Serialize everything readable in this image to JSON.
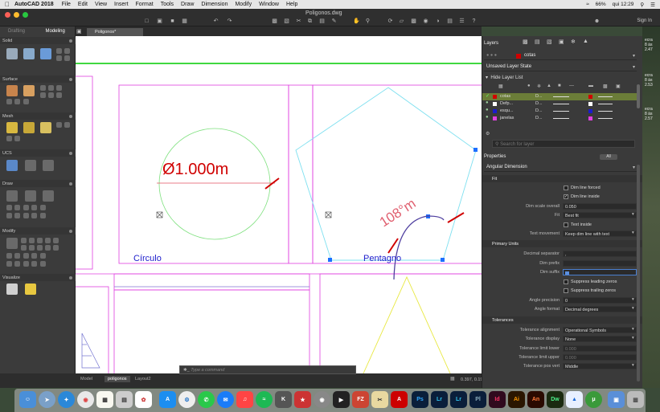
{
  "menubar": {
    "app_name": "AutoCAD 2018",
    "items": [
      "File",
      "Edit",
      "View",
      "Insert",
      "Format",
      "Tools",
      "Draw",
      "Dimension",
      "Modify",
      "Window",
      "Help"
    ],
    "battery": "66%",
    "clock": "qui 12:29"
  },
  "window": {
    "title": "Poligonos.dwg",
    "sign_in": "Sign In"
  },
  "left_palette": {
    "tabs": [
      "Drafting",
      "Modeling"
    ],
    "sections": [
      "Solid",
      "Surface",
      "Mesh",
      "UCS",
      "Draw",
      "Modify",
      "Visualize"
    ]
  },
  "doc_tab": "Poligonos*",
  "drawing": {
    "circle_label": "Círculo",
    "pentagon_label": "Pentagno",
    "diameter_text": "Ø1.000m",
    "angle_text": "108°m",
    "colors": {
      "magenta": "#e040e0",
      "cyan": "#7fe0f0",
      "green": "#00cc00",
      "red": "#d00000",
      "blue": "#1c1ccc",
      "yellow": "#e8e840",
      "purple": "#7060c0",
      "dim_red": "#e05060"
    }
  },
  "layout_tabs": [
    "Model",
    "poligonos",
    "Layout2"
  ],
  "command_placeholder": "Type a command",
  "coordinates": "0.397, 0.199, 0.000",
  "layers": {
    "header": "Layers",
    "current_layer": "cotas",
    "layer_state": "Unsaved Layer State",
    "hide_list": "Hide Layer List",
    "rows": [
      {
        "name": "cotas",
        "col": "D...",
        "color": "#d00000"
      },
      {
        "name": "Defp...",
        "col": "D...",
        "color": "#ffffff"
      },
      {
        "name": "esqu...",
        "col": "D...",
        "color": "#1c1ccc"
      },
      {
        "name": "janelas",
        "col": "D...",
        "color": "#e040e0"
      }
    ],
    "search_placeholder": "Search for layer"
  },
  "properties": {
    "header": "Properties",
    "all_toggle": "All",
    "object_type": "Angular Dimension",
    "fit": {
      "title": "Fit",
      "dim_line_forced": "Dim line forced",
      "dim_line_inside": "Dim line inside",
      "dim_scale_overall_label": "Dim scale overall",
      "dim_scale_overall": "0.050",
      "fit_label": "Fit",
      "fit_value": "Best fit",
      "text_inside": "Text inside",
      "text_movement_label": "Text movement",
      "text_movement": "Keep dim line with text"
    },
    "primary_units": {
      "title": "Primary Units",
      "decimal_separator_label": "Decimal separator",
      "decimal_separator": ",",
      "dim_prefix_label": "Dim prefix",
      "dim_suffix_label": "Dim suffix",
      "suppress_leading": "Suppress leading zeros",
      "suppress_trailing": "Suppress trailing zeros",
      "angle_precision_label": "Angle precision",
      "angle_precision": "0",
      "angle_format_label": "Angle format",
      "angle_format": "Decimal degrees"
    },
    "tolerances": {
      "title": "Tolerances",
      "alignment_label": "Tolerance alignment",
      "alignment": "Operational Symbols",
      "display_label": "Tolerance display",
      "display": "None",
      "limit_lower_label": "Tolerance limit lower",
      "limit_lower": "0.000",
      "limit_upper_label": "Tolerance limit upper",
      "limit_upper": "0.000",
      "pos_vert_label": "Tolerance pos vert",
      "pos_vert": "Middle"
    }
  },
  "bg_strip": [
    "ecra",
    "8 às",
    "2.47",
    "ecra",
    "8 às",
    "2.53",
    "ecra",
    "8 às",
    "2.57"
  ],
  "dock_apps": [
    "Ps",
    "Lr",
    "Lr",
    "Pl",
    "Id",
    "Ai",
    "An",
    "Dw"
  ]
}
